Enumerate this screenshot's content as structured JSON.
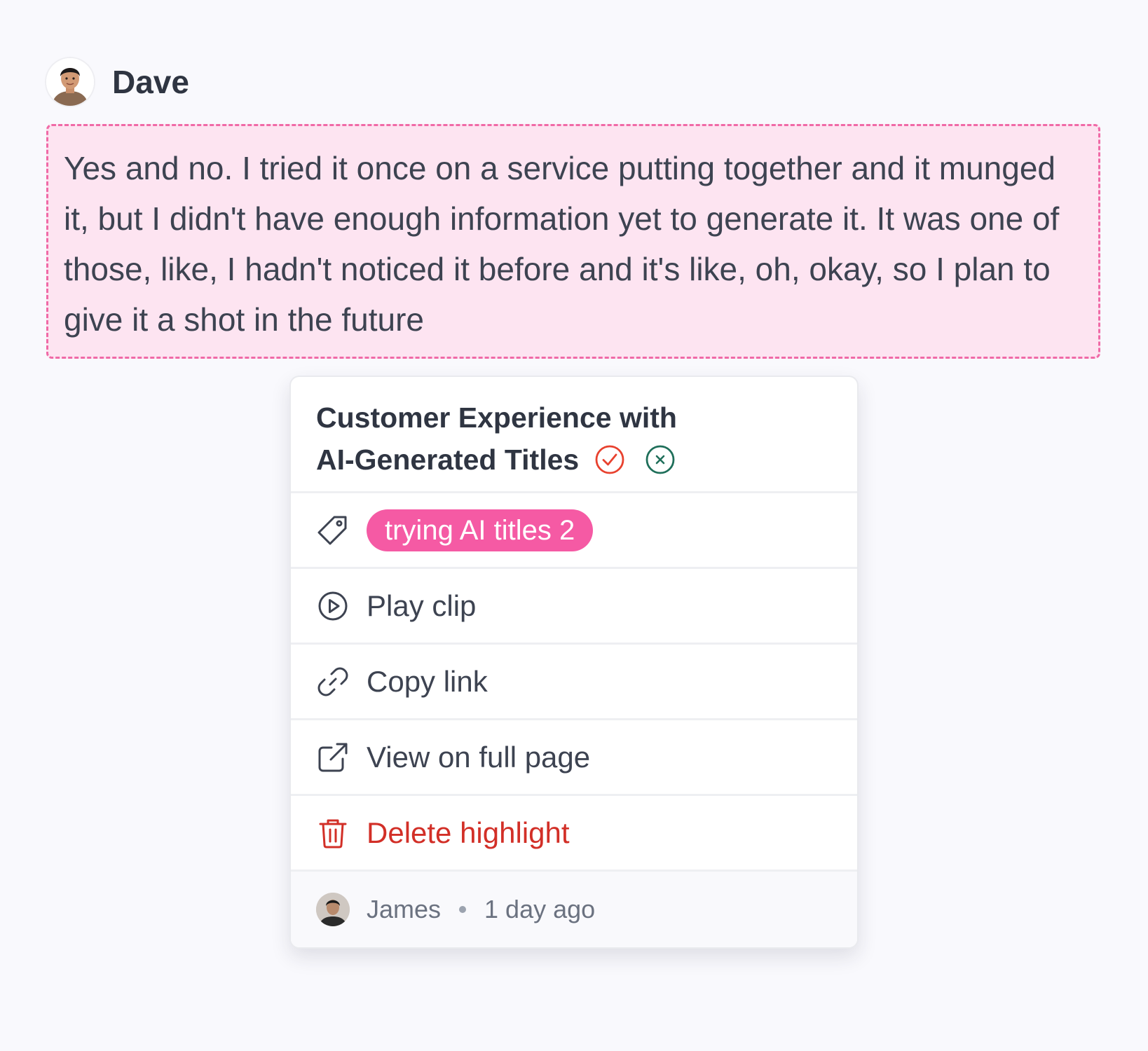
{
  "speaker": {
    "name": "Dave"
  },
  "transcript": {
    "text": "Yes and no. I tried it once on a service putting together and it munged it, but I didn't have enough information yet to generate it. It was one of those, like, I hadn't noticed it before and it's like, oh, okay, so I plan to give it a shot in the future"
  },
  "highlight_card": {
    "title_line1": "Customer Experience with",
    "title_line2": "AI-Generated Titles",
    "accept_icon": "check-circle-icon",
    "reject_icon": "x-circle-icon",
    "tag": {
      "icon": "tag-icon",
      "label": "trying AI titles 2",
      "color": "#f55aa4"
    },
    "actions": [
      {
        "icon": "play-circle-icon",
        "label": "Play clip"
      },
      {
        "icon": "link-icon",
        "label": "Copy link"
      },
      {
        "icon": "external-link-icon",
        "label": "View on full page"
      },
      {
        "icon": "trash-icon",
        "label": "Delete highlight",
        "color": "#d22f27"
      }
    ],
    "footer": {
      "author": "James",
      "time": "1 day ago"
    }
  },
  "colors": {
    "highlight_bg": "#fde4f1",
    "highlight_border": "#f06aa7",
    "accept": "#e8412e",
    "reject": "#1f6f5a"
  }
}
